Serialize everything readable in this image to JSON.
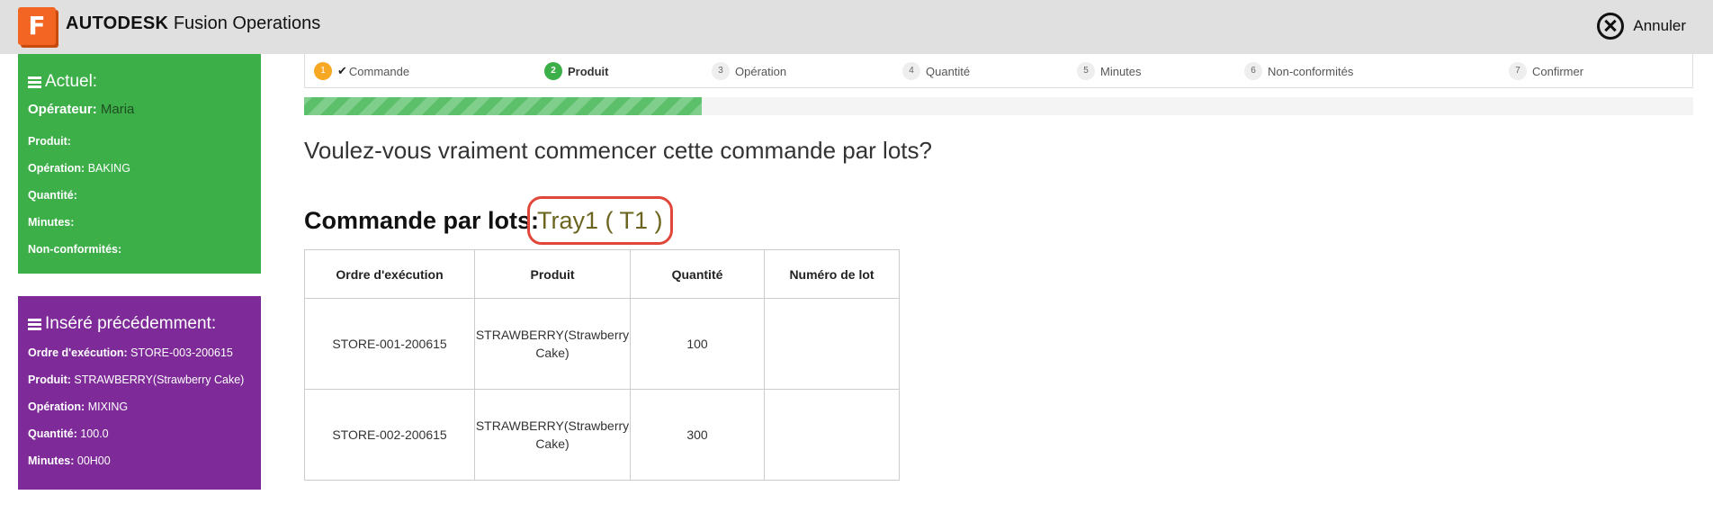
{
  "header": {
    "logo_letter": "F",
    "brand_bold": "AUTODESK",
    "brand_rest": " Fusion Operations",
    "cancel_label": "Annuler"
  },
  "current": {
    "title": "Actuel:",
    "operator_label": "Opérateur:",
    "operator_value": "Maria",
    "rows": [
      {
        "label": "Produit:",
        "value": ""
      },
      {
        "label": "Opération:",
        "value": "BAKING"
      },
      {
        "label": "Quantité:",
        "value": ""
      },
      {
        "label": "Minutes:",
        "value": ""
      },
      {
        "label": "Non-conformités:",
        "value": ""
      }
    ]
  },
  "previous": {
    "title": "Inséré précédemment:",
    "rows": [
      {
        "label": "Ordre d'exécution:",
        "value": "STORE-003-200615"
      },
      {
        "label": "Produit:",
        "value": "STRAWBERRY(Strawberry Cake)"
      },
      {
        "label": "Opération:",
        "value": "MIXING"
      },
      {
        "label": "Quantité:",
        "value": "100.0"
      },
      {
        "label": "Minutes:",
        "value": "00H00"
      }
    ]
  },
  "steps": [
    {
      "num": "1",
      "label": "Commande",
      "state": "done",
      "check": "✔"
    },
    {
      "num": "2",
      "label": "Produit",
      "state": "active"
    },
    {
      "num": "3",
      "label": "Opération",
      "state": "todo"
    },
    {
      "num": "4",
      "label": "Quantité",
      "state": "todo"
    },
    {
      "num": "5",
      "label": "Minutes",
      "state": "todo"
    },
    {
      "num": "6",
      "label": "Non-conformités",
      "state": "todo"
    },
    {
      "num": "7",
      "label": "Confirmer",
      "state": "todo"
    }
  ],
  "progress_fraction": 0.286,
  "colors": {
    "current_panel": "#3daf49",
    "previous_panel": "#7e2a98",
    "accent_orange": "#f26522",
    "highlight_red": "#e0473a"
  },
  "main": {
    "question": "Voulez-vous vraiment commencer cette commande par lots?",
    "lot_label": "Commande par lots:",
    "lot_value": "Tray1 ( T1 )"
  },
  "table": {
    "headers": [
      "Ordre d'exécution",
      "Produit",
      "Quantité",
      "Numéro de lot"
    ],
    "rows": [
      [
        "STORE-001-200615",
        "STRAWBERRY(Strawberry Cake)",
        "100",
        ""
      ],
      [
        "STORE-002-200615",
        "STRAWBERRY(Strawberry Cake)",
        "300",
        ""
      ]
    ]
  }
}
